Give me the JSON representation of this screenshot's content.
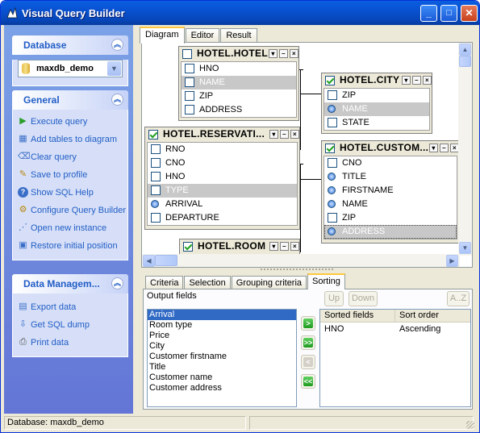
{
  "window": {
    "title": "Visual Query Builder",
    "min": "_",
    "max": "□",
    "close": "✕"
  },
  "sidebar": {
    "database": {
      "title": "Database",
      "selected": "maxdb_demo"
    },
    "general": {
      "title": "General",
      "items": [
        {
          "label": "Execute query",
          "icon": "play-icon"
        },
        {
          "label": "Add tables to diagram",
          "icon": "table-add-icon"
        },
        {
          "label": "Clear query",
          "icon": "clear-icon"
        },
        {
          "label": "Save to profile",
          "icon": "save-icon"
        },
        {
          "label": "Show SQL Help",
          "icon": "help-icon"
        },
        {
          "label": "Configure Query Builder",
          "icon": "configure-icon"
        },
        {
          "label": "Open new instance",
          "icon": "chart-icon"
        },
        {
          "label": "Restore initial position",
          "icon": "restore-icon"
        }
      ]
    },
    "data_management": {
      "title": "Data Managem...",
      "items": [
        {
          "label": "Export data",
          "icon": "export-icon"
        },
        {
          "label": "Get SQL dump",
          "icon": "dump-icon"
        },
        {
          "label": "Print data",
          "icon": "print-icon"
        }
      ]
    }
  },
  "tabs": [
    "Diagram",
    "Editor",
    "Result"
  ],
  "diagram": {
    "tables": {
      "hotel": {
        "name": "HOTEL.HOTEL",
        "fields": [
          "HNO",
          "NAME",
          "ZIP",
          "ADDRESS"
        ]
      },
      "city": {
        "name": "HOTEL.CITY",
        "fields": [
          "ZIP",
          "NAME",
          "STATE"
        ]
      },
      "reservation": {
        "name": "HOTEL.RESERVATI...",
        "fields": [
          "RNO",
          "CNO",
          "HNO",
          "TYPE",
          "ARRIVAL",
          "DEPARTURE"
        ]
      },
      "customer": {
        "name": "HOTEL.CUSTOM...",
        "fields": [
          "CNO",
          "TITLE",
          "FIRSTNAME",
          "NAME",
          "ZIP",
          "ADDRESS"
        ]
      },
      "room": {
        "name": "HOTEL.ROOM"
      }
    }
  },
  "bottom_tabs": [
    "Criteria",
    "Selection",
    "Grouping criteria",
    "Sorting"
  ],
  "sorting": {
    "output_label": "Output fields",
    "output_fields": [
      "Arrival",
      "Room type",
      "Price",
      "City",
      "Customer firstname",
      "Title",
      "Customer name",
      "Customer address"
    ],
    "up": "Up",
    "down": "Down",
    "az": "A..Z",
    "sorted_header": "Sorted fields",
    "order_header": "Sort order",
    "sorted": [
      {
        "field": "HNO",
        "order": "Ascending"
      }
    ],
    "arrows": [
      ">",
      ">>",
      "<",
      "<<"
    ]
  },
  "status": {
    "database": "Database: maxdb_demo"
  }
}
